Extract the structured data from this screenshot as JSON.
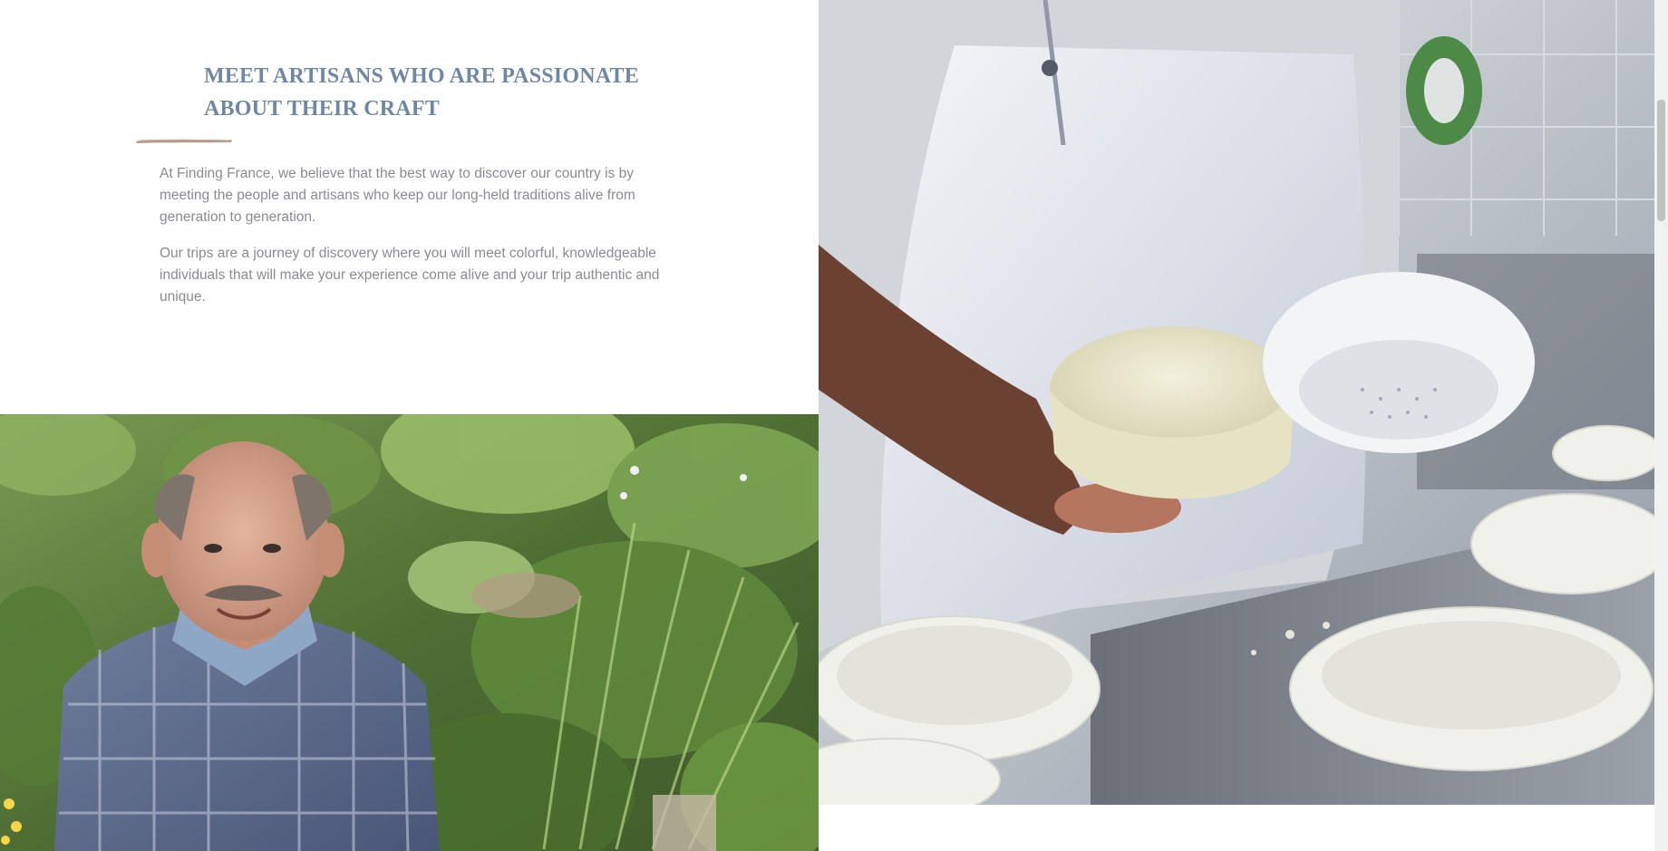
{
  "section": {
    "title_line1": "MEET ARTISANS WHO ARE PASSIONATE",
    "title_line2": "ABOUT THEIR CRAFT",
    "paragraph1": "At Finding France, we believe that the best way to discover our country is by meeting the people and artisans who keep our long-held traditions alive from generation to generation.",
    "paragraph2": "Our trips are a journey of discovery where you will meet colorful, knowledgeable individuals that will make your experience come alive and your trip authentic and unique."
  },
  "images": {
    "left": "artisan-gardener-photo",
    "right": "cheesemaker-photo"
  },
  "colors": {
    "title": "#6e87a6",
    "body_text": "#8a8a95",
    "brush_accent": "#b59a88"
  }
}
